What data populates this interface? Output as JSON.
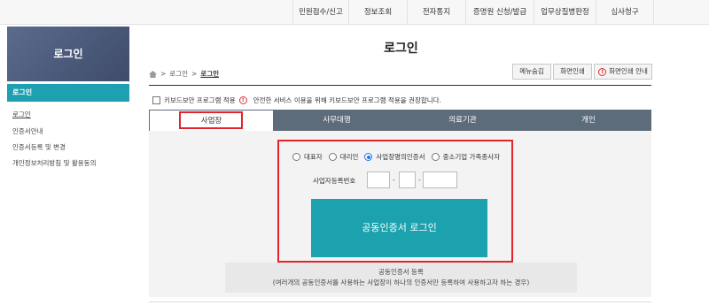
{
  "topnav": {
    "items": [
      "민원접수/신고",
      "정보조회",
      "전자통지",
      "증명원 신청/발급",
      "업무상질병판정",
      "심사청구"
    ]
  },
  "sidebar": {
    "banner_title": "로그인",
    "active_item": "로그인",
    "items": [
      "로그인",
      "인증서안내",
      "인증서등록 및 변경",
      "개인정보처리방침 및 활용동의"
    ]
  },
  "main": {
    "title": "로그인",
    "breadcrumb": [
      ">",
      "로그인",
      ">",
      "로그인"
    ],
    "buttons": {
      "menu_hide": "메뉴숨김",
      "print": "화면인쇄",
      "print_guide": "화면인쇄 안내"
    },
    "keyboard_notice": {
      "checkbox_label": "키보드보안 프로그램 적용",
      "warning": "안전한 서비스 이용을 위해 키보드보안 프로그램 적용을 권장합니다."
    },
    "tabs": [
      "사업장",
      "사무대행",
      "의료기관",
      "개인"
    ],
    "active_tab": "사업장",
    "radios": [
      "대표자",
      "대리인",
      "사업장명의인증서",
      "중소기업 가족종사자"
    ],
    "selected_radio": "사업장명의인증서",
    "brn_label": "사업자등록번호",
    "brn_dash": "-",
    "login_button": "공동인증서 로그인",
    "register": {
      "title": "공동인증서 등록",
      "desc": "(여러개의 공동인증서를 사용하는 사업장이 하나의 인증서만 등록하여 사용하고자 하는 경우)"
    }
  },
  "colors": {
    "accent": "#1ba2ae",
    "active_side": "#1f9fb2",
    "tab_bar": "#5d6c7b",
    "highlight": "#e3242b"
  }
}
